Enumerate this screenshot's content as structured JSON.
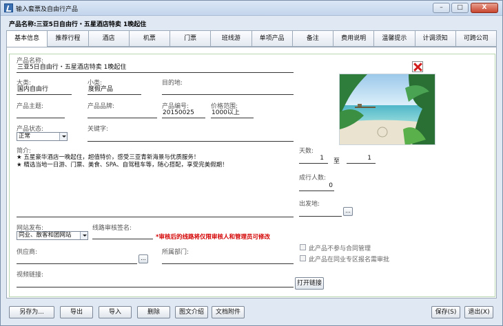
{
  "window": {
    "title": "输入套票及自由行产品",
    "controls": [
      "–",
      "□",
      "X"
    ]
  },
  "header": {
    "product_line": "产品名称:三亚5日自由行・五星酒店特卖 1晚起住"
  },
  "tabs": [
    {
      "label": "基本信息",
      "active": true
    },
    {
      "label": "推荐行程"
    },
    {
      "label": "酒店"
    },
    {
      "label": "机票"
    },
    {
      "label": "门票"
    },
    {
      "label": "班线游"
    },
    {
      "label": "单项产品"
    },
    {
      "label": "备注"
    },
    {
      "label": "费用说明"
    },
    {
      "label": "温馨提示"
    },
    {
      "label": "计调须知"
    },
    {
      "label": "可跨公司"
    }
  ],
  "form": {
    "product_name": {
      "label": "产品名称:",
      "value": "三亚5日自由行・五星酒店特卖 1晚起住"
    },
    "category": {
      "label": "大类:",
      "value": "国内自由行"
    },
    "subcategory": {
      "label": "小类:",
      "value": "度假产品"
    },
    "destination": {
      "label": "目的地:",
      "value": ""
    },
    "theme": {
      "label": "产品主题:",
      "value": ""
    },
    "brand": {
      "label": "产品品牌:",
      "value": ""
    },
    "code": {
      "label": "产品编号:",
      "value": "20150025"
    },
    "price_range": {
      "label": "价格范围:",
      "value": "1000以上"
    },
    "status": {
      "label": "产品状态:",
      "value": "正常"
    },
    "keywords": {
      "label": "关键字:",
      "value": ""
    },
    "intro": {
      "label": "简介:",
      "lines": [
        "★ 五星豪华酒店一晚起住，超值特价，感受三亚青新海景与优质服务！",
        "★ 精选当地一日游、门票、美食、SPA、自驾租车等，随心搭配，享受完美假期！"
      ]
    },
    "days": {
      "label": "天数:",
      "from": "1",
      "to_label": "至",
      "to": "1"
    },
    "min_people": {
      "label": "成行人数:",
      "value": "0"
    },
    "departure": {
      "label": "出发地:",
      "value": "",
      "button": "..."
    },
    "publish": {
      "label": "网站发布:",
      "value": "同业、散客和团网站"
    },
    "signer": {
      "label": "线路审核签名:",
      "value": ""
    },
    "warning": "*审核后的线路将仅限审核人和管理员可修改",
    "supplier": {
      "label": "供应商:",
      "value": "",
      "button": "..."
    },
    "department": {
      "label": "所属部门:",
      "value": ""
    },
    "video": {
      "label": "视频链接:",
      "value": "",
      "button": "打开链接"
    },
    "checkbox_contract": "此产品不参与合同管理",
    "checkbox_review": "此产品在同业专区报名需审批"
  },
  "buttons": {
    "save_as": "另存为...",
    "export": "导出",
    "import": "导入",
    "delete": "删除",
    "pic_intro": "图文介绍",
    "attachment": "文档附件",
    "save": "保存(S)",
    "exit": "退出(X)"
  }
}
